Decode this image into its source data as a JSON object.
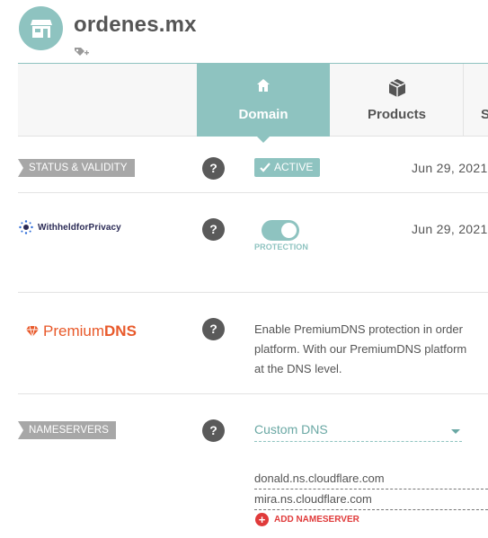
{
  "header": {
    "domain": "ordenes.mx",
    "store_icon": "store-icon",
    "tag_icon": "add-tag-icon"
  },
  "tabs": [
    {
      "label": "Domain",
      "icon": "home-icon",
      "active": true
    },
    {
      "label": "Products",
      "icon": "box-icon",
      "active": false
    },
    {
      "label": "S",
      "icon": "",
      "active": false
    }
  ],
  "status": {
    "label": "STATUS & VALIDITY",
    "badge": "ACTIVE",
    "date": "Jun 29, 2021"
  },
  "privacy": {
    "logo_text": "WithheldforPrivacy",
    "toggle_caption": "PROTECTION",
    "toggle_on": true,
    "date": "Jun 29, 2021"
  },
  "premium_dns": {
    "logo_regular": "Premium",
    "logo_bold": "DNS",
    "description_lines": [
      "Enable PremiumDNS protection in order",
      "platform. With our PremiumDNS platform",
      "at the DNS level."
    ]
  },
  "nameservers": {
    "label": "NAMESERVERS",
    "selected": "Custom DNS",
    "entries": [
      "donald.ns.cloudflare.com",
      "mira.ns.cloudflare.com"
    ],
    "add_label": "ADD NAMESERVER"
  },
  "help_text": "?",
  "colors": {
    "accent": "#8ec3c0",
    "label_bg": "#a7a7a7",
    "premium": "#e8592a",
    "add": "#e03a3a"
  }
}
